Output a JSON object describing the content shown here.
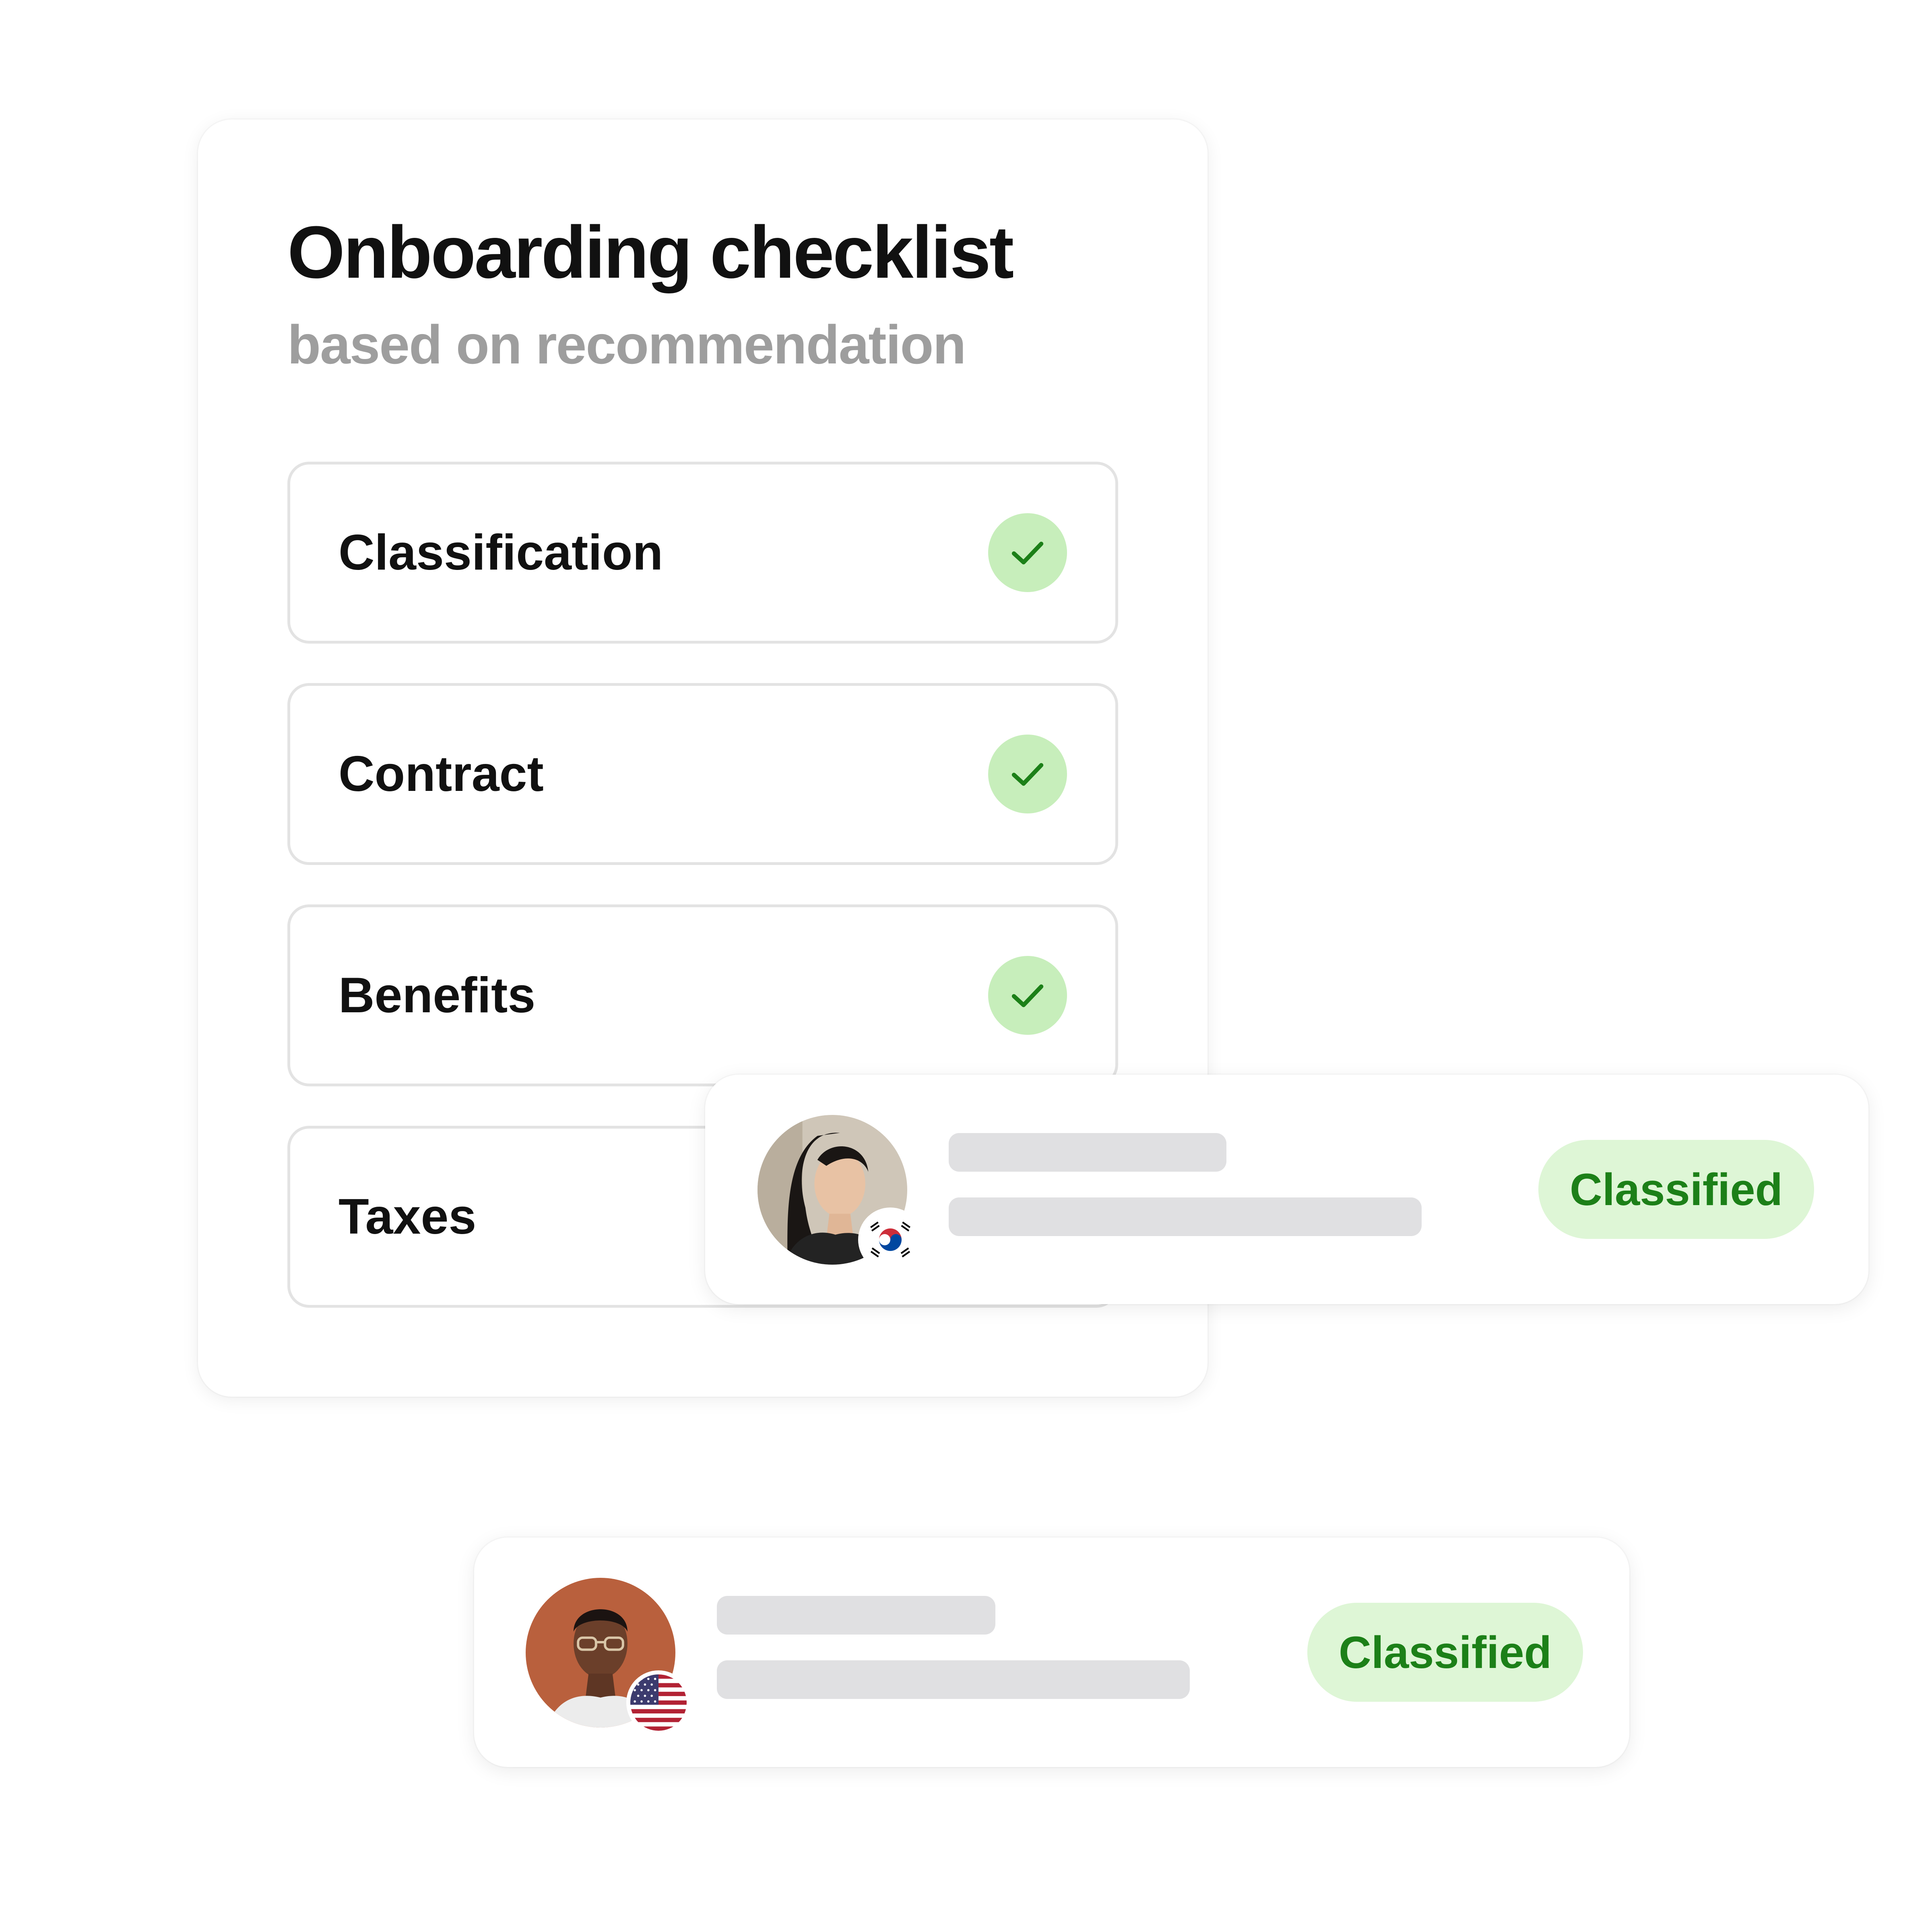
{
  "checklist": {
    "title": "Onboarding checklist",
    "subtitle": "based on recommendation",
    "items": [
      {
        "label": "Classification",
        "completed": true
      },
      {
        "label": "Contract",
        "completed": true
      },
      {
        "label": "Benefits",
        "completed": true
      },
      {
        "label": "Taxes",
        "completed": false
      }
    ]
  },
  "people": [
    {
      "status": "Classified",
      "flag_icon": "south-korea-flag-icon"
    },
    {
      "status": "Classified",
      "flag_icon": "united-states-flag-icon"
    }
  ],
  "colors": {
    "check_bg": "#c7eebb",
    "check_mark": "#1c8018",
    "badge_bg": "#def6d6",
    "badge_text": "#1c8018",
    "placeholder_bar": "#e0e0e2",
    "subtitle": "#9e9e9e"
  }
}
